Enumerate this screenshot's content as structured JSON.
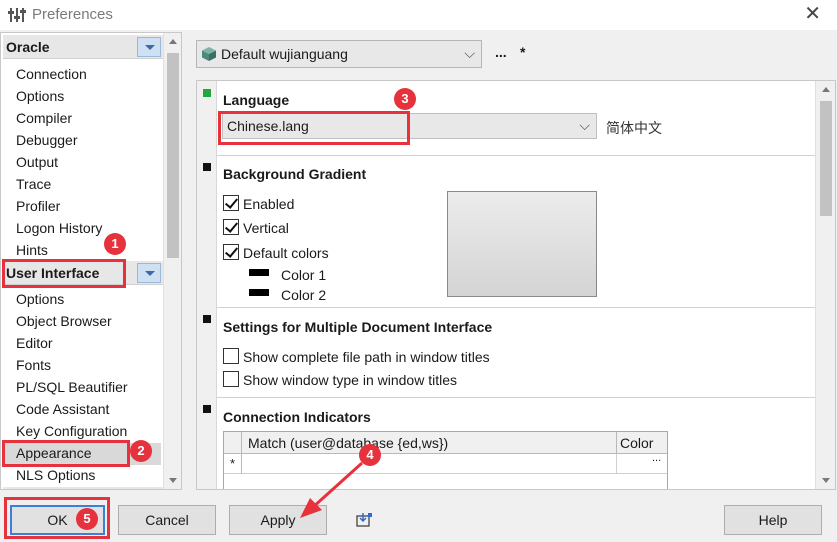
{
  "window": {
    "title": "Preferences",
    "close_glyph": "✕"
  },
  "nav": {
    "sections": [
      {
        "label": "Oracle",
        "items": [
          "Connection",
          "Options",
          "Compiler",
          "Debugger",
          "Output",
          "Trace",
          "Profiler",
          "Logon History",
          "Hints"
        ]
      },
      {
        "label": "User Interface",
        "items": [
          "Options",
          "Object Browser",
          "Editor",
          "Fonts",
          "PL/SQL Beautifier",
          "Code Assistant",
          "Key Configuration",
          "Appearance",
          "NLS Options"
        ]
      }
    ],
    "selected_item": "Appearance"
  },
  "profile": {
    "value": "Default wujianguang",
    "dots_label": "...",
    "star_label": "*"
  },
  "language": {
    "title": "Language",
    "value": "Chinese.lang",
    "native_name": "简体中文"
  },
  "background_gradient": {
    "title": "Background Gradient",
    "enabled_label": "Enabled",
    "enabled": true,
    "vertical_label": "Vertical",
    "vertical": true,
    "default_colors_label": "Default colors",
    "default_colors": true,
    "color1_label": "Color 1",
    "color2_label": "Color 2",
    "color1": "#000000",
    "color2": "#000000"
  },
  "mdi": {
    "title": "Settings for Multiple Document Interface",
    "full_path_label": "Show complete file path in window titles",
    "full_path": false,
    "window_type_label": "Show window type in window titles",
    "window_type": false
  },
  "connection_indicators": {
    "title": "Connection Indicators",
    "columns": [
      "Match (user@database {ed,ws})",
      "Color"
    ],
    "new_row_marker": "*",
    "ellipsis": "..."
  },
  "buttons": {
    "ok": "OK",
    "cancel": "Cancel",
    "apply": "Apply",
    "help": "Help"
  },
  "annotations": {
    "badges": [
      "1",
      "2",
      "3",
      "4",
      "5"
    ],
    "color": "#e5323c"
  }
}
